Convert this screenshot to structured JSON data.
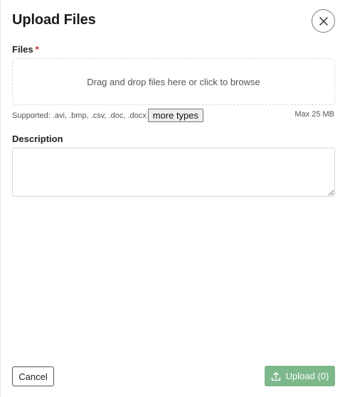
{
  "dialog": {
    "title": "Upload Files",
    "close_icon": "close-icon"
  },
  "files": {
    "label": "Files",
    "required_marker": "*",
    "dropzone_text": "Drag and drop files here or click to browse",
    "supported_text": "Supported: .avi, .bmp, .csv, .doc, .docx",
    "more_types_label": "more types",
    "max_size_text": "Max 25 MB"
  },
  "description": {
    "label": "Description",
    "value": ""
  },
  "footer": {
    "cancel_label": "Cancel",
    "upload_label": "Upload (0)",
    "upload_icon": "upload-icon",
    "upload_color": "#7db88b"
  }
}
